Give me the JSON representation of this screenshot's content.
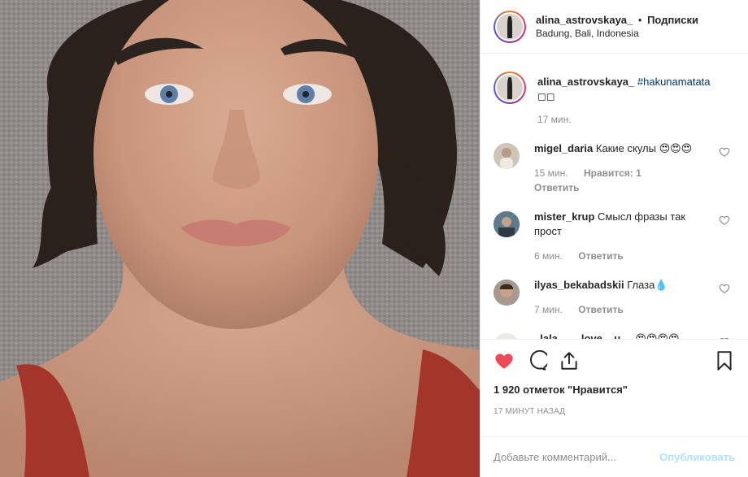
{
  "post": {
    "username": "alina_astrovskaya_",
    "separator": "•",
    "follow_label": "Подписки",
    "location": "Badung, Bali, Indonesia"
  },
  "caption": {
    "username": "alina_astrovskaya_",
    "hashtag": "#hakunamatata",
    "second_line": "◻◻",
    "time": "17 мин."
  },
  "comments": [
    {
      "username": "migel_daria",
      "text": "Какие скулы 😍😍😍",
      "time": "15 мин.",
      "likes": "Нравится: 1",
      "reply": "Ответить"
    },
    {
      "username": "mister_krup",
      "text": "Смысл фразы так прост",
      "time": "6 мин.",
      "likes": "",
      "reply": "Ответить"
    },
    {
      "username": "ilyas_bekabadskii",
      "text": "Глаза💧",
      "time": "7 мин.",
      "likes": "",
      "reply": "Ответить"
    },
    {
      "username": "_lala____love__u__",
      "text": "😍😍😍😍",
      "time": "",
      "likes": "",
      "reply": ""
    }
  ],
  "actions": {
    "likes_count": "1 920 отметок \"Нравится\"",
    "posted_ago": "17 МИНУТ НАЗАД"
  },
  "add_comment": {
    "placeholder": "Добавьте комментарий...",
    "publish_label": "Опубликовать"
  },
  "colors": {
    "like_red": "#ed4956",
    "link_blue": "#003569",
    "publish_disabled": "#b2dffc"
  }
}
